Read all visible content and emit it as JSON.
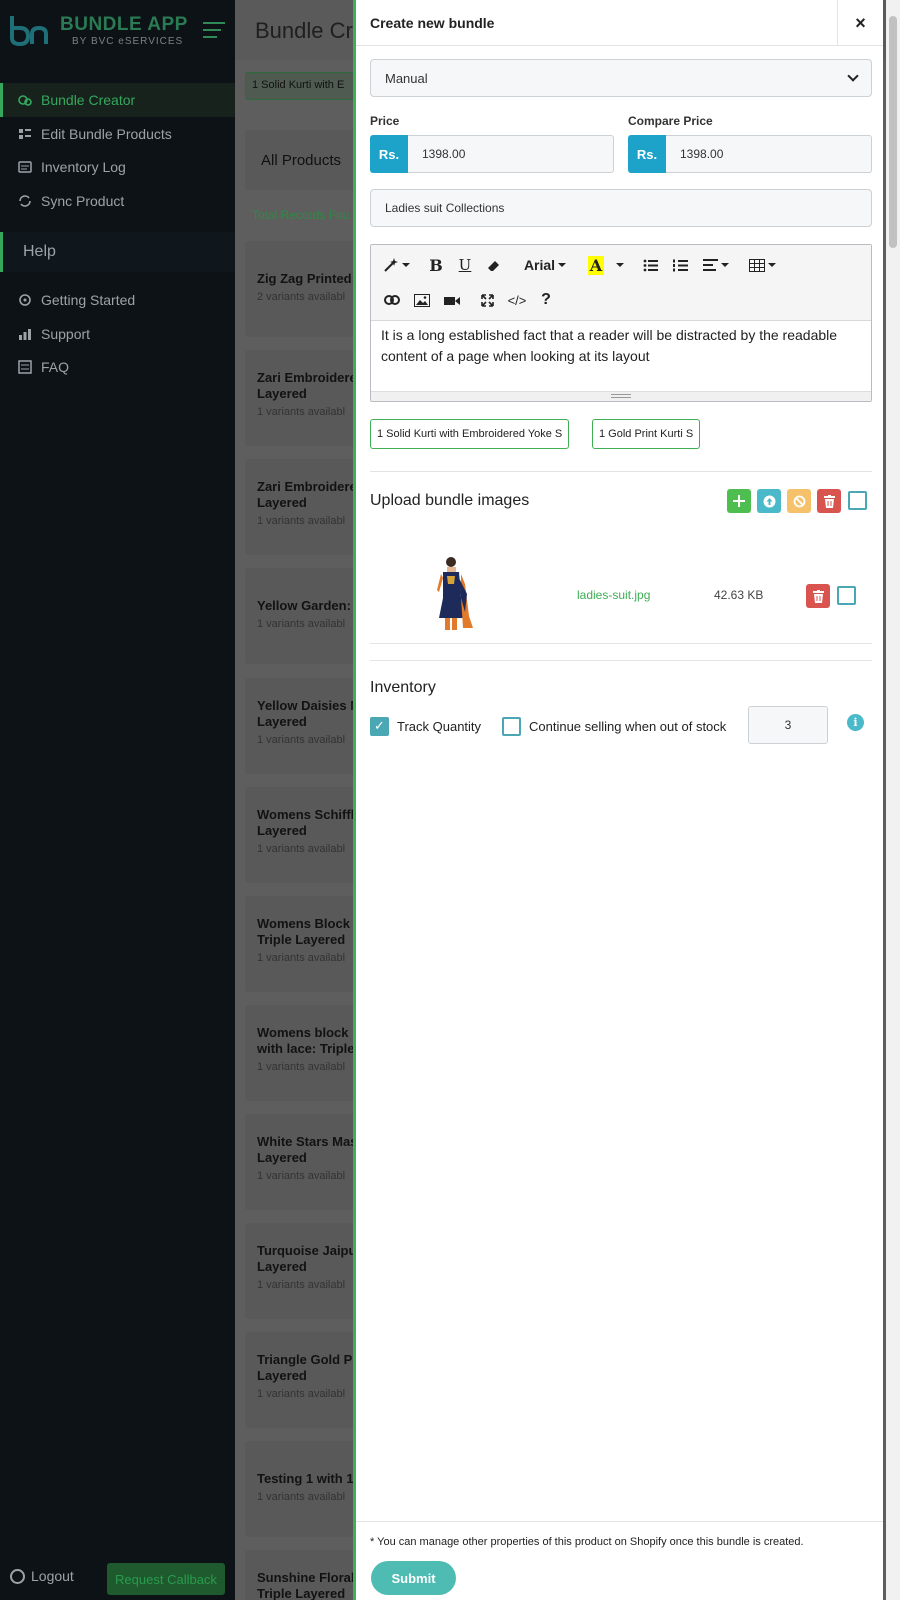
{
  "sidebar": {
    "logo_title": "BUNDLE APP",
    "logo_sub": "BY BVC eSERVICES",
    "items": [
      {
        "label": "Bundle Creator"
      },
      {
        "label": "Edit Bundle Products"
      },
      {
        "label": "Inventory Log"
      },
      {
        "label": "Sync Product"
      }
    ],
    "help_heading": "Help",
    "help_items": [
      {
        "label": "Getting Started"
      },
      {
        "label": "Support"
      },
      {
        "label": "FAQ"
      }
    ],
    "logout": "Logout",
    "callback": "Request Callback"
  },
  "main": {
    "title": "Bundle Cr",
    "chip": "1 Solid Kurti with E",
    "all_products": "All Products",
    "total_records": "Total Records Fou",
    "products": [
      {
        "name": "Zig Zag Printed:",
        "sub": "2 variants availabl"
      },
      {
        "name": "Zari Embroidere\nLayered",
        "sub": "1 variants availabl"
      },
      {
        "name": "Zari Embroidere\nLayered",
        "sub": "1 variants availabl"
      },
      {
        "name": "Yellow Garden: T",
        "sub": "1 variants availabl"
      },
      {
        "name": "Yellow Daisies M\nLayered",
        "sub": "1 variants availabl"
      },
      {
        "name": "Womens Schiffli\nLayered",
        "sub": "1 variants availabl"
      },
      {
        "name": "Womens Block P\nTriple Layered",
        "sub": "1 variants availabl"
      },
      {
        "name": "Womens block p\nwith lace: Triple I",
        "sub": "1 variants availabl"
      },
      {
        "name": "White Stars Mas\nLayered",
        "sub": "1 variants availabl"
      },
      {
        "name": "Turquoise Jaipur\nLayered",
        "sub": "1 variants availabl"
      },
      {
        "name": "Triangle Gold Pri\nLayered",
        "sub": "1 variants availabl"
      },
      {
        "name": "Testing 1 with 10",
        "sub": "1 variants availabl"
      },
      {
        "name": "Sunshine Floral E\nTriple Layered",
        "sub": ""
      }
    ]
  },
  "drawer": {
    "title": "Create new bundle",
    "close": "×",
    "bundle_type": "Manual",
    "price_label": "Price",
    "compare_label": "Compare Price",
    "currency": "Rs.",
    "price_value": "1398.00",
    "compare_value": "1398.00",
    "bundle_title": "Ladies suit Collections",
    "editor": {
      "font": "Arial",
      "body": "It is a long established fact that a reader will be distracted by the readable content of a page when looking at its layout"
    },
    "chips": [
      "1 Solid Kurti with Embroidered Yoke S",
      "1 Gold Print Kurti S"
    ],
    "upload_title": "Upload bundle images",
    "image": {
      "file_name": "ladies-suit.jpg",
      "file_size": "42.63 KB"
    },
    "inventory_title": "Inventory",
    "track_quantity": "Track Quantity",
    "continue_selling": "Continue selling when out of stock",
    "quantity": "3",
    "footer_note": "* You can manage other properties of this product on Shopify once this bundle is created.",
    "submit": "Submit"
  },
  "colors": {
    "accent_green": "#3fae55",
    "rs_blue": "#1da3c9",
    "teal": "#4fbcb3",
    "add_btn": "#4dbe4f",
    "upload_btn": "#4ab9c9",
    "cancel_btn": "#f5c26b",
    "delete_btn": "#d9534f"
  }
}
